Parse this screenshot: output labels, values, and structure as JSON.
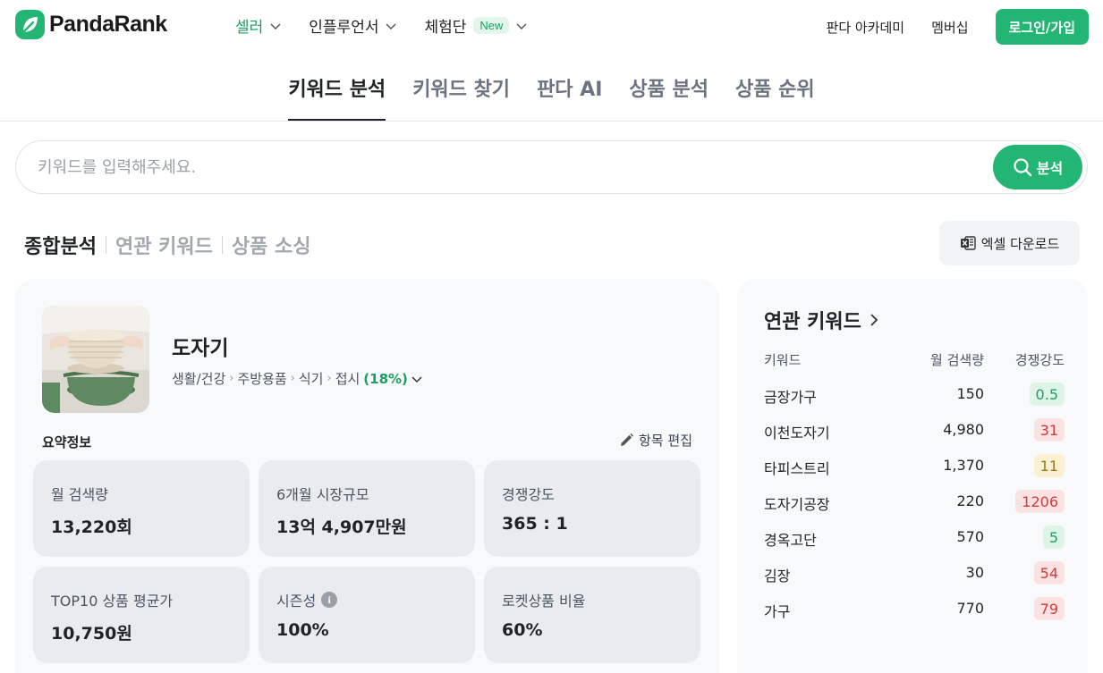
{
  "brand": {
    "name": "PandaRank",
    "accent": "#22b573"
  },
  "topnav": {
    "items": [
      {
        "label": "셀러",
        "active": true
      },
      {
        "label": "인플루언서",
        "active": false
      },
      {
        "label": "체험단",
        "badge": "New",
        "active": false
      }
    ],
    "links": [
      "판다 아카데미",
      "멤버십"
    ],
    "login_label": "로그인/가입"
  },
  "tabs": [
    {
      "label": "키워드 분석",
      "active": true
    },
    {
      "label": "키워드 찾기",
      "active": false
    },
    {
      "label": "판다 AI",
      "active": false
    },
    {
      "label": "상품 분석",
      "active": false
    },
    {
      "label": "상품 순위",
      "active": false
    }
  ],
  "search": {
    "placeholder": "키워드를 입력해주세요.",
    "value": "",
    "button_label": "분석"
  },
  "subtabs": [
    {
      "label": "종합분석",
      "active": true
    },
    {
      "label": "연관 키워드",
      "active": false
    },
    {
      "label": "상품 소싱",
      "active": false
    }
  ],
  "excel_label": "엑셀 다운로드",
  "keyword": {
    "title": "도자기",
    "category": [
      "생활/건강",
      "주방용품",
      "식기",
      "접시"
    ],
    "category_pct": "(18%)"
  },
  "summary": {
    "label": "요약정보",
    "edit_label": "항목 편집",
    "stats": [
      {
        "label": "월 검색량",
        "value": "13,220회"
      },
      {
        "label": "6개월 시장규모",
        "value": "13억 4,907만원"
      },
      {
        "label": "경쟁강도",
        "value": "365 : 1"
      },
      {
        "label": "TOP10 상품 평균가",
        "value": "10,750원"
      },
      {
        "label": "시즌성",
        "value": "100%",
        "info": "i"
      },
      {
        "label": "로켓상품 비율",
        "value": "60%"
      }
    ]
  },
  "related": {
    "title": "연관 키워드",
    "headers": {
      "keyword": "키워드",
      "volume": "월 검색량",
      "competition": "경쟁강도"
    },
    "rows": [
      {
        "keyword": "금장가구",
        "volume": "150",
        "competition": "0.5",
        "level": "low"
      },
      {
        "keyword": "이천도자기",
        "volume": "4,980",
        "competition": "31",
        "level": "high"
      },
      {
        "keyword": "타피스트리",
        "volume": "1,370",
        "competition": "11",
        "level": "mid"
      },
      {
        "keyword": "도자기공장",
        "volume": "220",
        "competition": "1206",
        "level": "high"
      },
      {
        "keyword": "경옥고단",
        "volume": "570",
        "competition": "5",
        "level": "low"
      },
      {
        "keyword": "김장",
        "volume": "30",
        "competition": "54",
        "level": "high"
      },
      {
        "keyword": "가구",
        "volume": "770",
        "competition": "79",
        "level": "high"
      }
    ]
  }
}
